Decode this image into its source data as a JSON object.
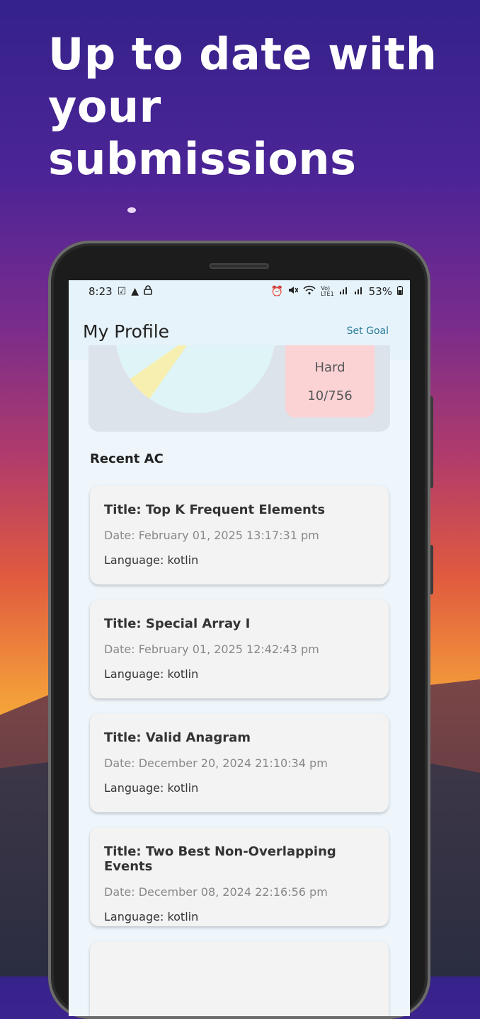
{
  "headline": {
    "line1": "Up to date with",
    "line2": "your submissions"
  },
  "status_bar": {
    "time": "8:23",
    "left_icons": [
      "check-square-icon",
      "warning-icon",
      "lock-icon"
    ],
    "right_icons": [
      "alarm-icon",
      "mute-icon",
      "wifi-icon",
      "volte-icon",
      "signal-icon",
      "signal-icon-2"
    ],
    "battery": "53%"
  },
  "appbar": {
    "title": "My Profile",
    "action": "Set Goal"
  },
  "difficulty": {
    "label": "Hard",
    "value": "10/756"
  },
  "recent": {
    "title": "Recent AC",
    "items": [
      {
        "title": "Title: Top K Frequent Elements",
        "date": "Date: February 01, 2025 13:17:31 pm",
        "language": "Language: kotlin"
      },
      {
        "title": "Title: Special Array I",
        "date": "Date: February 01, 2025 12:42:43 pm",
        "language": "Language: kotlin"
      },
      {
        "title": "Title: Valid Anagram",
        "date": "Date: December 20, 2024 21:10:34 pm",
        "language": "Language: kotlin"
      },
      {
        "title": "Title: Two Best Non-Overlapping Events",
        "date": "Date: December 08, 2024 22:16:56 pm",
        "language": "Language: kotlin"
      }
    ]
  },
  "colors": {
    "accent": "#2a7a99",
    "hard_bg": "#fbd3d5",
    "card_bg": "#f3f3f3",
    "screen_bg": "#eef6fc"
  }
}
